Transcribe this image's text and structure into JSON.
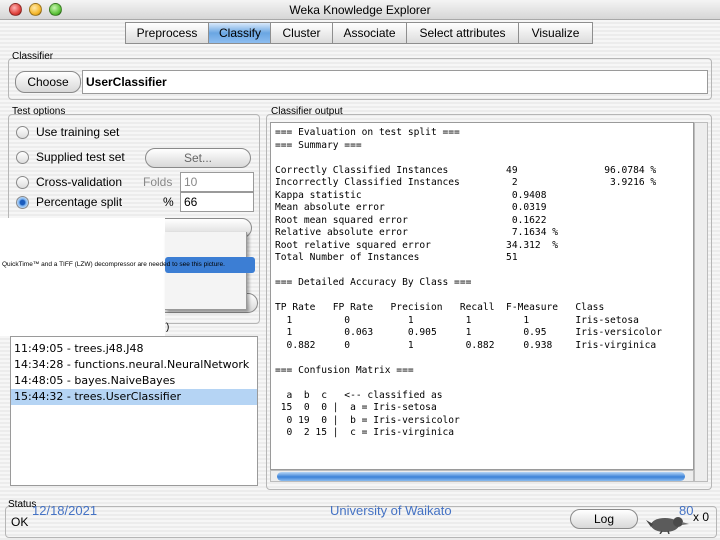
{
  "window": {
    "title": "Weka Knowledge Explorer"
  },
  "tabs": [
    "Preprocess",
    "Classify",
    "Cluster",
    "Associate",
    "Select attributes",
    "Visualize"
  ],
  "classifier": {
    "group_label": "Classifier",
    "choose_label": "Choose",
    "name": "UserClassifier"
  },
  "test_options": {
    "group_label": "Test options",
    "use_training_set": "Use training set",
    "supplied_test_set": "Supplied test set",
    "set_button": "Set...",
    "cross_validation": "Cross-validation",
    "folds_label": "Folds",
    "folds_value": "10",
    "percentage_split": "Percentage split",
    "percent_symbol": "%",
    "percent_value": "66",
    "selected_option": "percentage_split"
  },
  "overlay_message": "QuickTime™ and a TIFF (LZW) decompressor are needed to see this picture.",
  "result_list": {
    "label_fragment": ")",
    "items": [
      "11:49:05 - trees.j48.J48",
      "14:34:28 - functions.neural.NeuralNetwork",
      "14:48:05 - bayes.NaiveBayes",
      "15:44:32 - trees.UserClassifier"
    ],
    "selected_index": 3
  },
  "output": {
    "group_label": "Classifier output",
    "lines": [
      "=== Evaluation on test split ===",
      "=== Summary ===",
      "",
      "Correctly Classified Instances          49               96.0784 %",
      "Incorrectly Classified Instances         2                3.9216 %",
      "Kappa statistic                          0.9408",
      "Mean absolute error                      0.0319",
      "Root mean squared error                  0.1622",
      "Relative absolute error                  7.1634 %",
      "Root relative squared error             34.312  %",
      "Total Number of Instances               51",
      "",
      "=== Detailed Accuracy By Class ===",
      "",
      "TP Rate   FP Rate   Precision   Recall  F-Measure   Class",
      "  1         0          1         1         1        Iris-setosa",
      "  1         0.063      0.905     1         0.95     Iris-versicolor",
      "  0.882     0          1         0.882     0.938    Iris-virginica",
      "",
      "=== Confusion Matrix ===",
      "",
      "  a  b  c   <-- classified as",
      " 15  0  0 |  a = Iris-setosa",
      "  0 19  0 |  b = Iris-versicolor",
      "  0  2 15 |  c = Iris-virginica"
    ]
  },
  "status": {
    "group_label": "Status",
    "text": "OK",
    "log_label": "Log",
    "x_count": "x 0"
  },
  "footer": {
    "date": "12/18/2021",
    "org": "University of Waikato",
    "page": "80"
  },
  "colors": {
    "active_tab": "#6aa6e2",
    "selection": "#b5d4f4",
    "footer_text": "#4472c4"
  }
}
